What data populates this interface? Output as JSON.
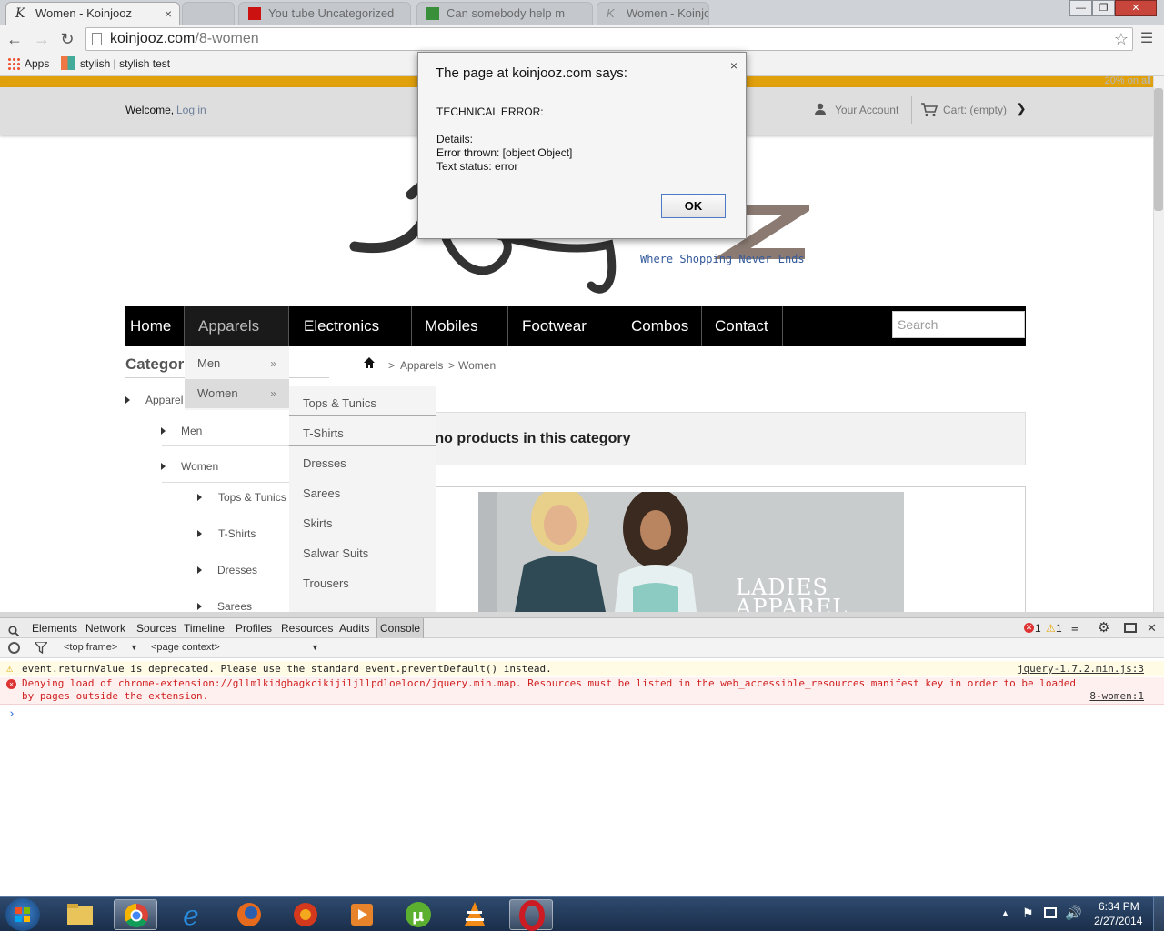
{
  "browser": {
    "tabs": [
      {
        "title": "Women - Koinjooz",
        "active": true
      },
      {
        "title": "",
        "active": false
      },
      {
        "title": "You tube Uncategorized",
        "active": false
      },
      {
        "title": "Can somebody help m",
        "active": false
      },
      {
        "title": "Women - Koinjooz",
        "active": false
      }
    ],
    "tab_close": "×",
    "window_buttons": {
      "minimize": "—",
      "maximize": "❐",
      "close": "✕"
    },
    "url_domain": "koinjooz.com",
    "url_path": "/8-women",
    "bookmarks": [
      {
        "label": "Apps",
        "icon": "apps-grid-icon"
      },
      {
        "label": "stylish | stylish test",
        "icon": "stylish-icon"
      }
    ]
  },
  "site": {
    "promo": "20% on all",
    "welcome": "Welcome,",
    "login": "Log in",
    "account": "Your Account",
    "cart": "Cart: (empty)",
    "tagline": "Where Shopping Never Ends",
    "nav": [
      "Home",
      "Apparels",
      "Electronics",
      "Mobiles",
      "Footwear",
      "Combos",
      "Contact"
    ],
    "search_placeholder": "Search",
    "category_title": "Categori",
    "categories": [
      {
        "label": "Apparel",
        "level": 0
      },
      {
        "label": "Men",
        "level": 1
      },
      {
        "label": "Women",
        "level": 1
      },
      {
        "label": "Tops & Tunics",
        "level": 2
      },
      {
        "label": "T-Shirts",
        "level": 2
      },
      {
        "label": "Dresses",
        "level": 2
      },
      {
        "label": "Sarees",
        "level": 2
      }
    ],
    "breadcrumb": {
      "sep": ">",
      "items": [
        "Apparels",
        "Women"
      ]
    },
    "no_products": "e no products in this category",
    "banner_text_line1": "LADIES",
    "banner_text_line2": "APPAREL",
    "dropdown1": [
      {
        "label": "Men",
        "arrow": "»"
      },
      {
        "label": "Women",
        "arrow": "»"
      }
    ],
    "dropdown2": [
      "Tops & Tunics",
      "T-Shirts",
      "Dresses",
      "Sarees",
      "Skirts",
      "Salwar Suits",
      "Trousers"
    ]
  },
  "alert": {
    "title": "The page at koinjooz.com says:",
    "close": "×",
    "line1": "TECHNICAL ERROR:",
    "line2": "Details:",
    "line3": "Error thrown: [object Object]",
    "line4": "Text status: error",
    "ok": "OK"
  },
  "devtools": {
    "tabs": [
      "Elements",
      "Network",
      "Sources",
      "Timeline",
      "Profiles",
      "Resources",
      "Audits",
      "Console"
    ],
    "selected_tab": "Console",
    "error_count": "1",
    "warning_count": "1",
    "frame_select": "<top frame>",
    "context_select": "<page context>",
    "messages": [
      {
        "type": "warning",
        "text": "event.returnValue is deprecated. Please use the standard event.preventDefault() instead.",
        "source": "jquery-1.7.2.min.js:3"
      },
      {
        "type": "error",
        "text_a": "Denying load of chrome-extension://gllmlkidgbagkcikijiljllpdloelocn/jquery.min.map.",
        "text_b": " Resources must be listed in the web_accessible_resources manifest key in order to be loaded",
        "text_c": "by pages outside the extension.",
        "source": "8-women:1"
      }
    ],
    "prompt": "›"
  },
  "taskbar": {
    "time": "6:34 PM",
    "date": "2/27/2014",
    "icons": [
      "explorer-folder-icon",
      "chrome-icon",
      "internet-explorer-icon",
      "firefox-icon",
      "firefox-nightly-icon",
      "media-player-icon",
      "utorrent-icon",
      "vlc-icon",
      "opera-icon"
    ]
  }
}
